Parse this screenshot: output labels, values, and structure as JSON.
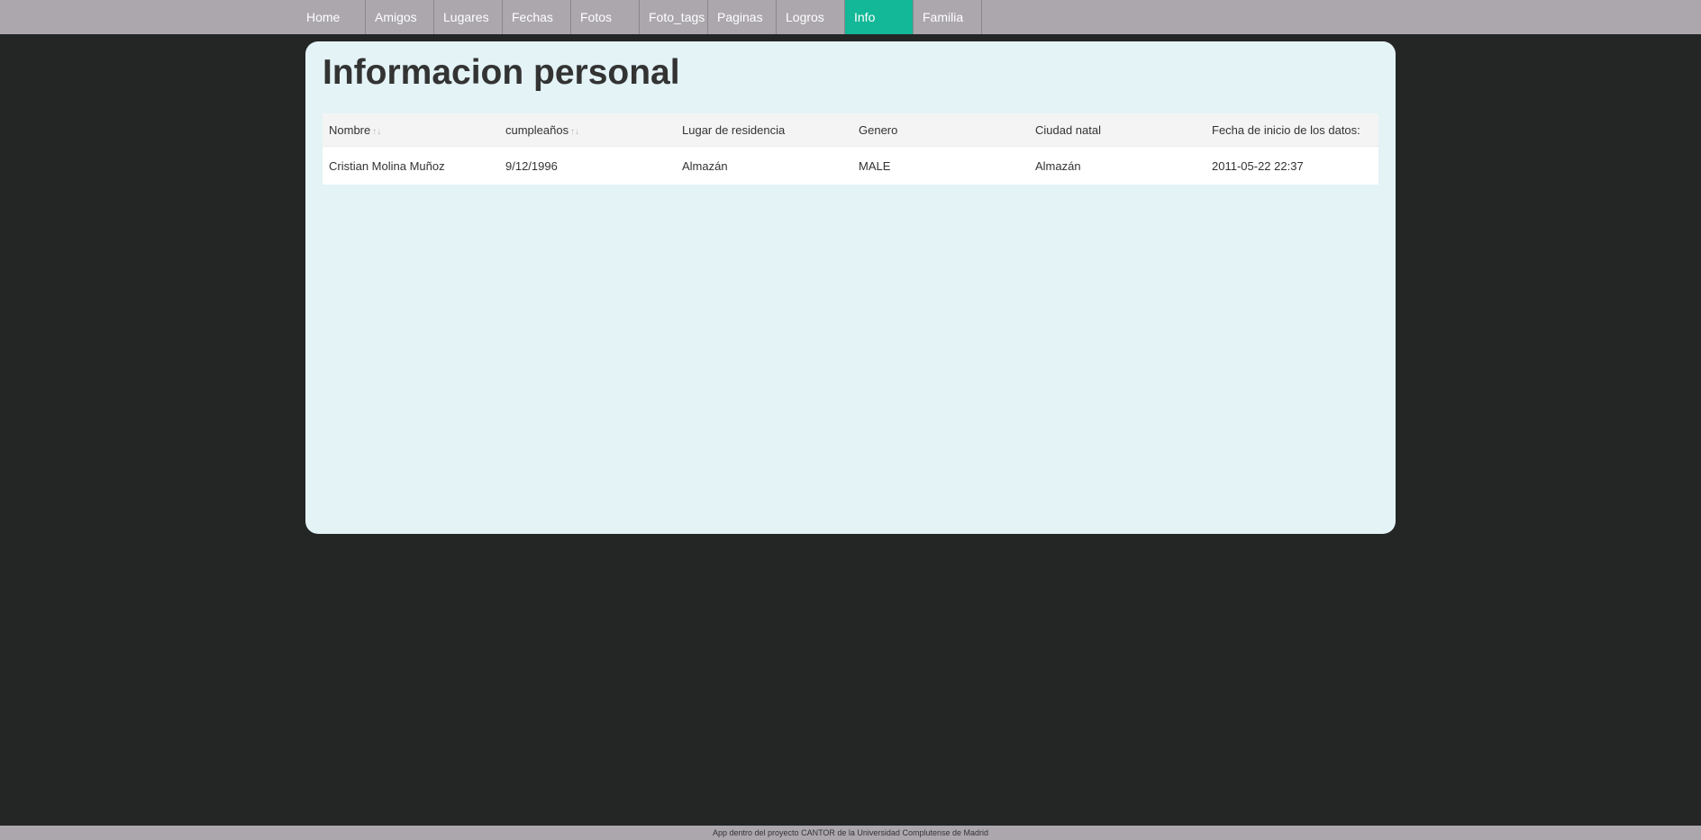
{
  "nav": {
    "items": [
      {
        "label": "Home"
      },
      {
        "label": "Amigos"
      },
      {
        "label": "Lugares"
      },
      {
        "label": "Fechas"
      },
      {
        "label": "Fotos"
      },
      {
        "label": "Foto_tags"
      },
      {
        "label": "Paginas"
      },
      {
        "label": "Logros"
      },
      {
        "label": "Info",
        "active": true
      },
      {
        "label": "Familia"
      }
    ],
    "active_color": "#12b897",
    "bar_color": "#aba7ad"
  },
  "main": {
    "title": "Informacion personal",
    "table": {
      "headers": [
        "Nombre",
        "cumpleaños",
        "Lugar de residencia",
        "Genero",
        "Ciudad natal",
        "Fecha de inicio de los datos:"
      ],
      "sort_icon": "↑↓",
      "rows": [
        [
          "Cristian Molina Muñoz",
          "9/12/1996",
          "Almazán",
          "MALE",
          "Almazán",
          "2011-05-22 22:37"
        ]
      ]
    }
  },
  "footer": {
    "text": "App dentro del proyecto CANTOR de la Universidad Complutense de Madrid"
  }
}
